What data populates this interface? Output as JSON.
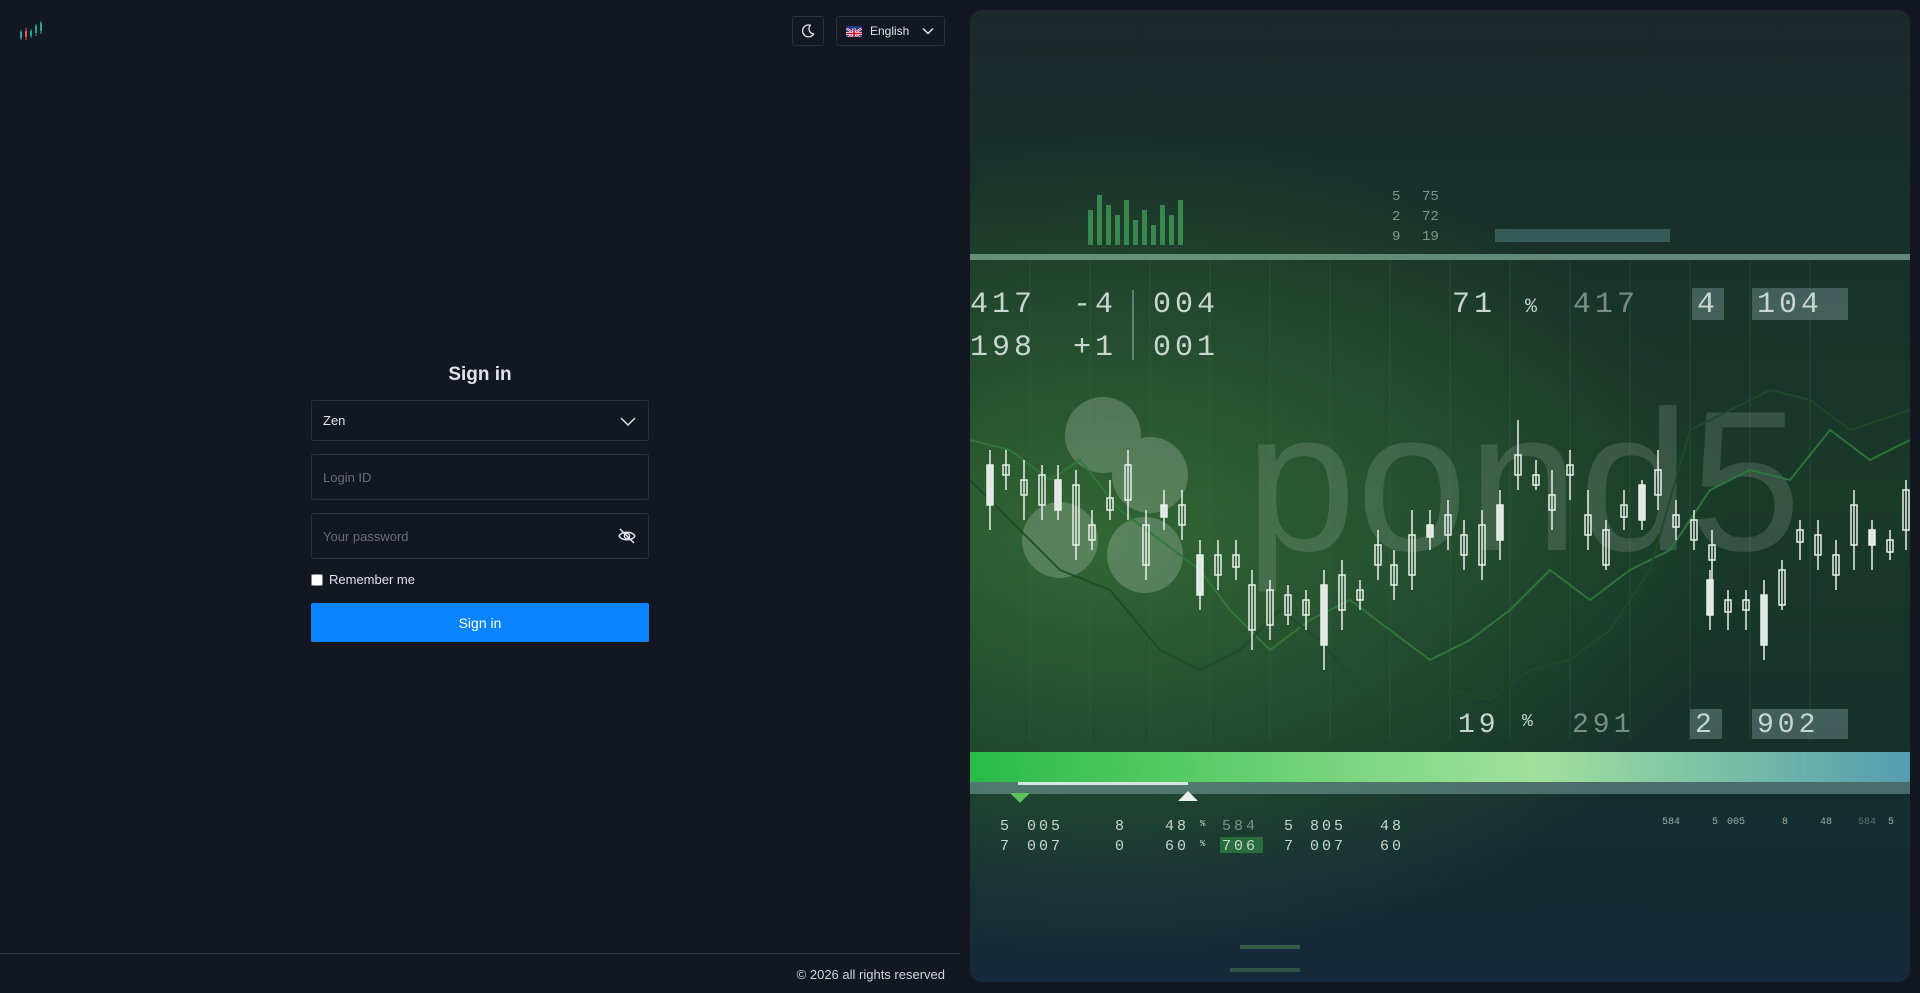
{
  "header": {
    "language": "English"
  },
  "form": {
    "title": "Sign in",
    "workspace_value": "Zen",
    "login_placeholder": "Login ID",
    "password_placeholder": "Your password",
    "remember_label": "Remember me",
    "submit_label": "Sign in"
  },
  "footer": {
    "copyright": "© 2026 all rights reserved"
  },
  "hero": {
    "watermark": "pond5",
    "top_numbers": [
      "5",
      "75",
      "2",
      "72",
      "9",
      "19"
    ],
    "row1": [
      "417",
      "-4",
      "004",
      "71",
      "%",
      "417",
      "4",
      "104"
    ],
    "row2": [
      "198",
      "+1",
      "001"
    ],
    "row3": [
      "19",
      "%",
      "291",
      "2",
      "902"
    ],
    "bottom1": [
      "5",
      "005",
      "8",
      "48",
      "%",
      "584",
      "5",
      "805",
      "48"
    ],
    "bottom2": [
      "7",
      "007",
      "0",
      "60",
      "%",
      "706",
      "7",
      "007",
      "60"
    ],
    "bottom_right": [
      "584",
      "5",
      "005",
      "8",
      "48",
      "584",
      "5"
    ]
  },
  "colors": {
    "background": "#131722",
    "accent": "#0a84ff",
    "border": "#2a2e39"
  },
  "icons": {
    "logo": "candlestick-logo-icon",
    "theme": "moon-icon",
    "flag": "uk-flag-icon",
    "dropdown": "chevron-down-icon",
    "password_toggle": "eye-off-icon"
  }
}
